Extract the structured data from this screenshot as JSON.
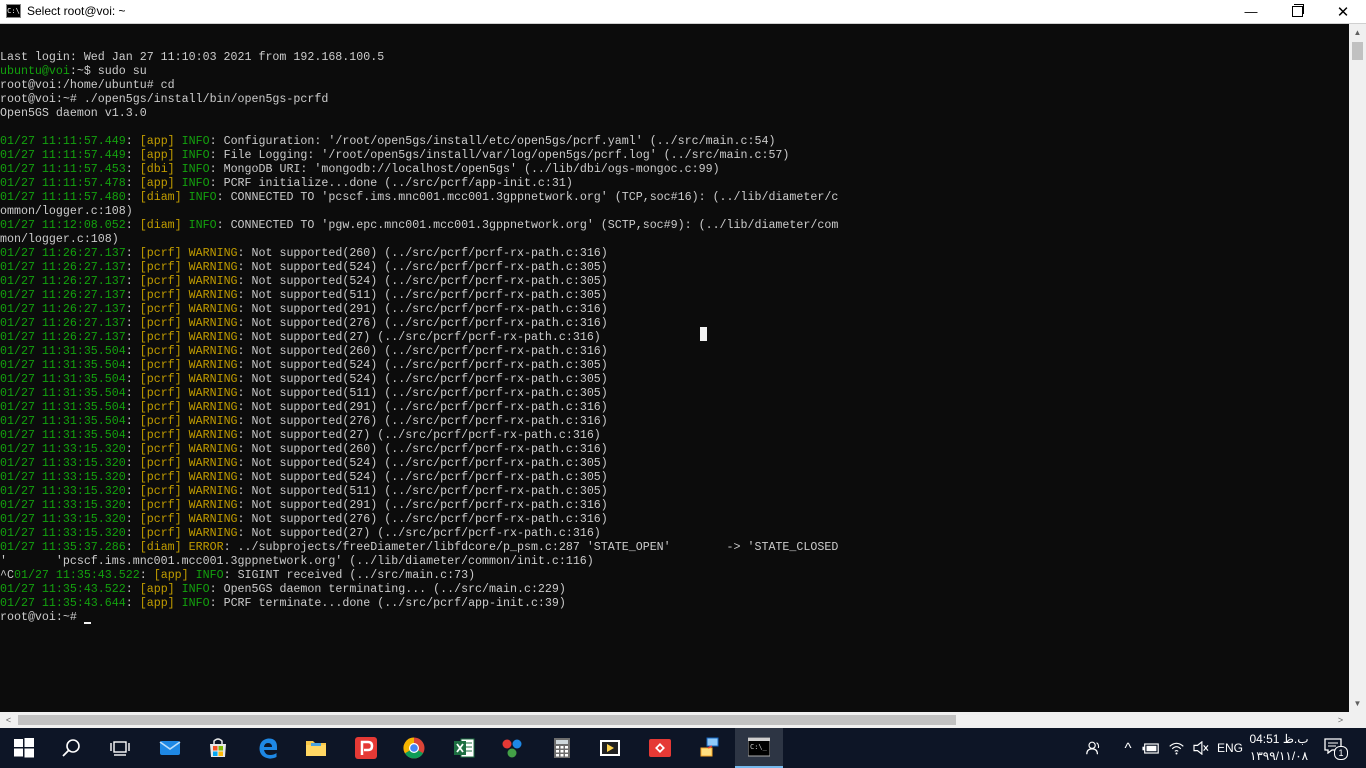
{
  "window": {
    "title": "Select root@voi: ~",
    "app_icon_text": "C:\\",
    "minimize_glyph": "—",
    "close_glyph": "✕"
  },
  "terminal": {
    "colors": {
      "background": "#0c0c0c",
      "text": "#cccccc",
      "timestamp": "#13a10e",
      "module": "#c19c00"
    },
    "lines": [
      [
        {
          "t": "Last login: Wed Jan 27 11:10:03 2021 from 192.168.100.5"
        }
      ],
      [
        {
          "t": "ubuntu@voi",
          "c": "g"
        },
        {
          "t": ":~$ sudo su"
        }
      ],
      [
        {
          "t": "root@voi:/home/ubuntu# cd"
        }
      ],
      [
        {
          "t": "root@voi:~# ./open5gs/install/bin/open5gs-pcrfd"
        }
      ],
      [
        {
          "t": "Open5GS daemon v1.3.0"
        }
      ],
      [
        {
          "t": ""
        }
      ],
      [
        {
          "t": "01/27 11:11:57.449",
          "c": "g"
        },
        {
          "t": ": "
        },
        {
          "t": "[app]",
          "c": "y"
        },
        {
          "t": " INFO",
          "c": "g"
        },
        {
          "t": ": Configuration: '/root/open5gs/install/etc/open5gs/pcrf.yaml' (../src/main.c:54)"
        }
      ],
      [
        {
          "t": "01/27 11:11:57.449",
          "c": "g"
        },
        {
          "t": ": "
        },
        {
          "t": "[app]",
          "c": "y"
        },
        {
          "t": " INFO",
          "c": "g"
        },
        {
          "t": ": File Logging: '/root/open5gs/install/var/log/open5gs/pcrf.log' (../src/main.c:57)"
        }
      ],
      [
        {
          "t": "01/27 11:11:57.453",
          "c": "g"
        },
        {
          "t": ": "
        },
        {
          "t": "[dbi]",
          "c": "y"
        },
        {
          "t": " INFO",
          "c": "g"
        },
        {
          "t": ": MongoDB URI: 'mongodb://localhost/open5gs' (../lib/dbi/ogs-mongoc.c:99)"
        }
      ],
      [
        {
          "t": "01/27 11:11:57.478",
          "c": "g"
        },
        {
          "t": ": "
        },
        {
          "t": "[app]",
          "c": "y"
        },
        {
          "t": " INFO",
          "c": "g"
        },
        {
          "t": ": PCRF initialize...done (../src/pcrf/app-init.c:31)"
        }
      ],
      [
        {
          "t": "01/27 11:11:57.480",
          "c": "g"
        },
        {
          "t": ": "
        },
        {
          "t": "[diam]",
          "c": "y"
        },
        {
          "t": " INFO",
          "c": "g"
        },
        {
          "t": ": CONNECTED TO 'pcscf.ims.mnc001.mcc001.3gppnetwork.org' (TCP,soc#16): (../lib/diameter/c"
        }
      ],
      [
        {
          "t": "ommon/logger.c:108)"
        }
      ],
      [
        {
          "t": "01/27 11:12:08.052",
          "c": "g"
        },
        {
          "t": ": "
        },
        {
          "t": "[diam]",
          "c": "y"
        },
        {
          "t": " INFO",
          "c": "g"
        },
        {
          "t": ": CONNECTED TO 'pgw.epc.mnc001.mcc001.3gppnetwork.org' (SCTP,soc#9): (../lib/diameter/com"
        }
      ],
      [
        {
          "t": "mon/logger.c:108)"
        }
      ],
      [
        {
          "t": "01/27 11:26:27.137",
          "c": "g"
        },
        {
          "t": ": "
        },
        {
          "t": "[pcrf]",
          "c": "y"
        },
        {
          "t": " WARNING",
          "c": "y"
        },
        {
          "t": ": Not supported(260) (../src/pcrf/pcrf-rx-path.c:316)"
        }
      ],
      [
        {
          "t": "01/27 11:26:27.137",
          "c": "g"
        },
        {
          "t": ": "
        },
        {
          "t": "[pcrf]",
          "c": "y"
        },
        {
          "t": " WARNING",
          "c": "y"
        },
        {
          "t": ": Not supported(524) (../src/pcrf/pcrf-rx-path.c:305)"
        }
      ],
      [
        {
          "t": "01/27 11:26:27.137",
          "c": "g"
        },
        {
          "t": ": "
        },
        {
          "t": "[pcrf]",
          "c": "y"
        },
        {
          "t": " WARNING",
          "c": "y"
        },
        {
          "t": ": Not supported(524) (../src/pcrf/pcrf-rx-path.c:305)"
        }
      ],
      [
        {
          "t": "01/27 11:26:27.137",
          "c": "g"
        },
        {
          "t": ": "
        },
        {
          "t": "[pcrf]",
          "c": "y"
        },
        {
          "t": " WARNING",
          "c": "y"
        },
        {
          "t": ": Not supported(511) (../src/pcrf/pcrf-rx-path.c:305)"
        }
      ],
      [
        {
          "t": "01/27 11:26:27.137",
          "c": "g"
        },
        {
          "t": ": "
        },
        {
          "t": "[pcrf]",
          "c": "y"
        },
        {
          "t": " WARNING",
          "c": "y"
        },
        {
          "t": ": Not supported(291) (../src/pcrf/pcrf-rx-path.c:316)"
        }
      ],
      [
        {
          "t": "01/27 11:26:27.137",
          "c": "g"
        },
        {
          "t": ": "
        },
        {
          "t": "[pcrf]",
          "c": "y"
        },
        {
          "t": " WARNING",
          "c": "y"
        },
        {
          "t": ": Not supported(276) (../src/pcrf/pcrf-rx-path.c:316)"
        }
      ],
      [
        {
          "t": "01/27 11:26:27.137",
          "c": "g"
        },
        {
          "t": ": "
        },
        {
          "t": "[pcrf]",
          "c": "y"
        },
        {
          "t": " WARNING",
          "c": "y"
        },
        {
          "t": ": Not supported(27) (../src/pcrf/pcrf-rx-path.c:316)"
        }
      ],
      [
        {
          "t": "01/27 11:31:35.504",
          "c": "g"
        },
        {
          "t": ": "
        },
        {
          "t": "[pcrf]",
          "c": "y"
        },
        {
          "t": " WARNING",
          "c": "y"
        },
        {
          "t": ": Not supported(260) (../src/pcrf/pcrf-rx-path.c:316)"
        }
      ],
      [
        {
          "t": "01/27 11:31:35.504",
          "c": "g"
        },
        {
          "t": ": "
        },
        {
          "t": "[pcrf]",
          "c": "y"
        },
        {
          "t": " WARNING",
          "c": "y"
        },
        {
          "t": ": Not supported(524) (../src/pcrf/pcrf-rx-path.c:305)"
        }
      ],
      [
        {
          "t": "01/27 11:31:35.504",
          "c": "g"
        },
        {
          "t": ": "
        },
        {
          "t": "[pcrf]",
          "c": "y"
        },
        {
          "t": " WARNING",
          "c": "y"
        },
        {
          "t": ": Not supported(524) (../src/pcrf/pcrf-rx-path.c:305)"
        }
      ],
      [
        {
          "t": "01/27 11:31:35.504",
          "c": "g"
        },
        {
          "t": ": "
        },
        {
          "t": "[pcrf]",
          "c": "y"
        },
        {
          "t": " WARNING",
          "c": "y"
        },
        {
          "t": ": Not supported(511) (../src/pcrf/pcrf-rx-path.c:305)"
        }
      ],
      [
        {
          "t": "01/27 11:31:35.504",
          "c": "g"
        },
        {
          "t": ": "
        },
        {
          "t": "[pcrf]",
          "c": "y"
        },
        {
          "t": " WARNING",
          "c": "y"
        },
        {
          "t": ": Not supported(291) (../src/pcrf/pcrf-rx-path.c:316)"
        }
      ],
      [
        {
          "t": "01/27 11:31:35.504",
          "c": "g"
        },
        {
          "t": ": "
        },
        {
          "t": "[pcrf]",
          "c": "y"
        },
        {
          "t": " WARNING",
          "c": "y"
        },
        {
          "t": ": Not supported(276) (../src/pcrf/pcrf-rx-path.c:316)"
        }
      ],
      [
        {
          "t": "01/27 11:31:35.504",
          "c": "g"
        },
        {
          "t": ": "
        },
        {
          "t": "[pcrf]",
          "c": "y"
        },
        {
          "t": " WARNING",
          "c": "y"
        },
        {
          "t": ": Not supported(27) (../src/pcrf/pcrf-rx-path.c:316)"
        }
      ],
      [
        {
          "t": "01/27 11:33:15.320",
          "c": "g"
        },
        {
          "t": ": "
        },
        {
          "t": "[pcrf]",
          "c": "y"
        },
        {
          "t": " WARNING",
          "c": "y"
        },
        {
          "t": ": Not supported(260) (../src/pcrf/pcrf-rx-path.c:316)"
        }
      ],
      [
        {
          "t": "01/27 11:33:15.320",
          "c": "g"
        },
        {
          "t": ": "
        },
        {
          "t": "[pcrf]",
          "c": "y"
        },
        {
          "t": " WARNING",
          "c": "y"
        },
        {
          "t": ": Not supported(524) (../src/pcrf/pcrf-rx-path.c:305)"
        }
      ],
      [
        {
          "t": "01/27 11:33:15.320",
          "c": "g"
        },
        {
          "t": ": "
        },
        {
          "t": "[pcrf]",
          "c": "y"
        },
        {
          "t": " WARNING",
          "c": "y"
        },
        {
          "t": ": Not supported(524) (../src/pcrf/pcrf-rx-path.c:305)"
        }
      ],
      [
        {
          "t": "01/27 11:33:15.320",
          "c": "g"
        },
        {
          "t": ": "
        },
        {
          "t": "[pcrf]",
          "c": "y"
        },
        {
          "t": " WARNING",
          "c": "y"
        },
        {
          "t": ": Not supported(511) (../src/pcrf/pcrf-rx-path.c:305)"
        }
      ],
      [
        {
          "t": "01/27 11:33:15.320",
          "c": "g"
        },
        {
          "t": ": "
        },
        {
          "t": "[pcrf]",
          "c": "y"
        },
        {
          "t": " WARNING",
          "c": "y"
        },
        {
          "t": ": Not supported(291) (../src/pcrf/pcrf-rx-path.c:316)"
        }
      ],
      [
        {
          "t": "01/27 11:33:15.320",
          "c": "g"
        },
        {
          "t": ": "
        },
        {
          "t": "[pcrf]",
          "c": "y"
        },
        {
          "t": " WARNING",
          "c": "y"
        },
        {
          "t": ": Not supported(276) (../src/pcrf/pcrf-rx-path.c:316)"
        }
      ],
      [
        {
          "t": "01/27 11:33:15.320",
          "c": "g"
        },
        {
          "t": ": "
        },
        {
          "t": "[pcrf]",
          "c": "y"
        },
        {
          "t": " WARNING",
          "c": "y"
        },
        {
          "t": ": Not supported(27) (../src/pcrf/pcrf-rx-path.c:316)"
        }
      ],
      [
        {
          "t": "01/27 11:35:37.286",
          "c": "g"
        },
        {
          "t": ": "
        },
        {
          "t": "[diam]",
          "c": "y"
        },
        {
          "t": " ERROR",
          "c": "y"
        },
        {
          "t": ": ../subprojects/freeDiameter/libfdcore/p_psm.c:287 'STATE_OPEN'        -> 'STATE_CLOSED"
        }
      ],
      [
        {
          "t": "'       'pcscf.ims.mnc001.mcc001.3gppnetwork.org' (../lib/diameter/common/init.c:116)"
        }
      ],
      [
        {
          "t": "^C"
        },
        {
          "t": "01/27 11:35:43.522",
          "c": "g"
        },
        {
          "t": ": "
        },
        {
          "t": "[app]",
          "c": "y"
        },
        {
          "t": " INFO",
          "c": "g"
        },
        {
          "t": ": SIGINT received (../src/main.c:73)"
        }
      ],
      [
        {
          "t": "01/27 11:35:43.522",
          "c": "g"
        },
        {
          "t": ": "
        },
        {
          "t": "[app]",
          "c": "y"
        },
        {
          "t": " INFO",
          "c": "g"
        },
        {
          "t": ": Open5GS daemon terminating... (../src/main.c:229)"
        }
      ],
      [
        {
          "t": "01/27 11:35:43.644",
          "c": "g"
        },
        {
          "t": ": "
        },
        {
          "t": "[app]",
          "c": "y"
        },
        {
          "t": " INFO",
          "c": "g"
        },
        {
          "t": ": PCRF terminate...done (../src/pcrf/app-init.c:39)"
        }
      ]
    ],
    "prompt": "root@voi:~# "
  },
  "scrollbars": {
    "up": "▲",
    "down": "▼",
    "left": "<",
    "right": ">"
  },
  "taskbar": {
    "apps": [
      {
        "name": "start-button-icon",
        "label": "Start"
      },
      {
        "name": "search-icon",
        "label": "Search"
      },
      {
        "name": "task-view-icon",
        "label": "Task View"
      },
      {
        "name": "mail-icon",
        "label": "Mail"
      },
      {
        "name": "store-icon",
        "label": "Microsoft Store"
      },
      {
        "name": "edge-icon",
        "label": "Microsoft Edge"
      },
      {
        "name": "file-explorer-icon",
        "label": "File Explorer"
      },
      {
        "name": "psiphon-icon",
        "label": "Psiphon"
      },
      {
        "name": "chrome-icon",
        "label": "Google Chrome"
      },
      {
        "name": "excel-icon",
        "label": "Excel"
      },
      {
        "name": "paint-3d-icon",
        "label": "Paint 3D"
      },
      {
        "name": "calculator-icon",
        "label": "Calculator"
      },
      {
        "name": "media-player-icon",
        "label": "Media Player"
      },
      {
        "name": "anydesk-icon",
        "label": "AnyDesk"
      },
      {
        "name": "network-app-icon",
        "label": "Network Tool"
      },
      {
        "name": "command-prompt-icon",
        "label": "Command Prompt",
        "active": true
      }
    ],
    "colors": {
      "background": "#0d1526",
      "active": "#2d3544",
      "accent": "#76b9ed"
    },
    "tray": {
      "people_icon": "people-icon",
      "chevron_glyph": "^",
      "language": "ENG",
      "time": "04:51 ب.ظ",
      "date": "۱۳۹۹/۱۱/۰۸",
      "notification_count": "1"
    }
  }
}
